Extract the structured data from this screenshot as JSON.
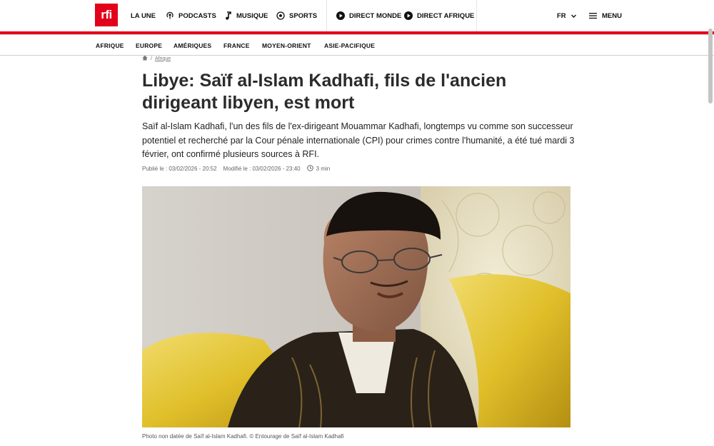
{
  "header": {
    "logo_text": "rfi",
    "brand_color": "#e2001a",
    "nav": [
      {
        "label": "LA UNE",
        "icon": ""
      },
      {
        "label": "PODCASTS",
        "icon": "podcast-icon"
      },
      {
        "label": "MUSIQUE",
        "icon": "music-note-icon"
      },
      {
        "label": "SPORTS",
        "icon": "soccer-ball-icon"
      },
      {
        "label": "DIRECT MONDE",
        "icon": "play-icon"
      },
      {
        "label": "DIRECT AFRIQUE",
        "icon": "play-icon"
      }
    ],
    "language": "FR",
    "menu_label": "MENU"
  },
  "subnav": [
    "AFRIQUE",
    "EUROPE",
    "AMÉRIQUES",
    "FRANCE",
    "MOYEN-ORIENT",
    "ASIE-PACIFIQUE"
  ],
  "breadcrumb": {
    "home_icon": "home-icon",
    "separator": "/",
    "section": "Afrique"
  },
  "article": {
    "title": "Libye: Saïf al-Islam Kadhafi, fils de l'ancien dirigeant libyen, est mort",
    "lead": "Saïf al-Islam Kadhafi, l'un des fils de l'ex-dirigeant Mouammar Kadhafi, longtemps vu comme son successeur potentiel et recherché par la Cour pénale internationale (CPI) pour crimes contre l'humanité, a été tué mardi 3 février, ont confirmé plusieurs sources à RFI.",
    "published": "Publié le : 03/02/2026 - 20:52",
    "modified": "Modifié le : 03/02/2026 - 23:40",
    "read_time": "3 min",
    "caption": "Photo non datée de Saïf al-Islam Kadhafi. © Entourage de Saïf al-Islam Kadhafi"
  }
}
